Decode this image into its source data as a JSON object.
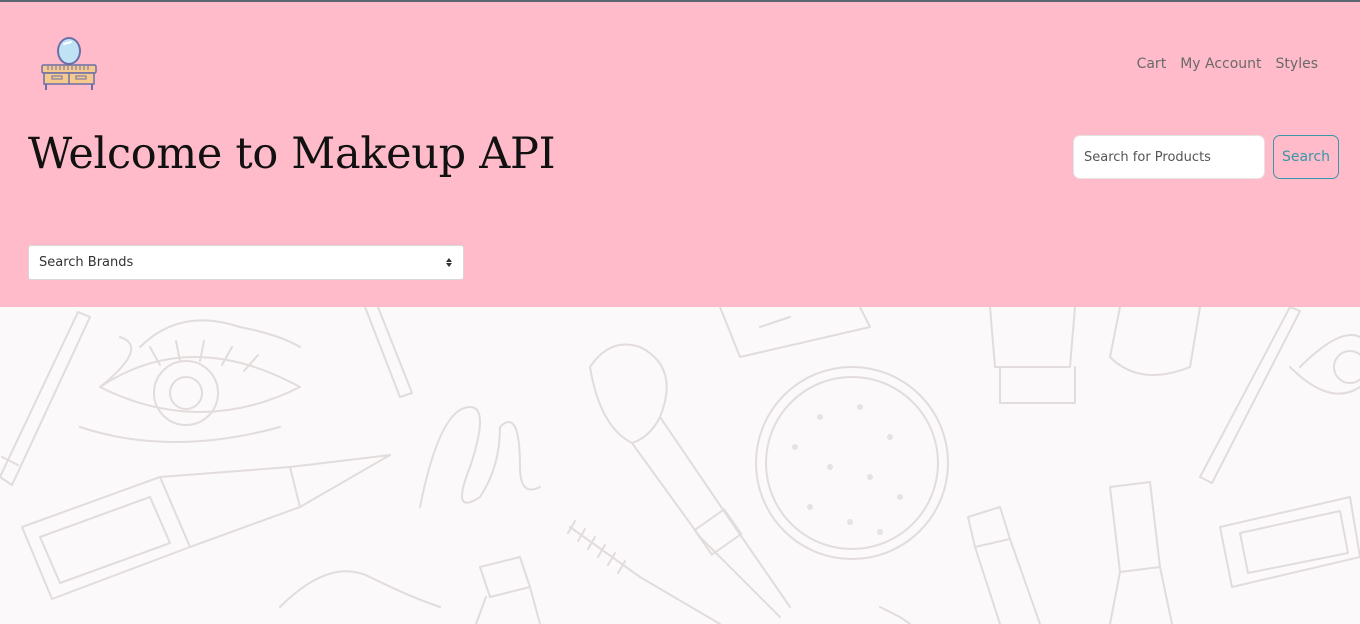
{
  "header": {
    "logo_icon": "vanity-mirror-icon",
    "nav": {
      "cart": "Cart",
      "my_account": "My Account",
      "styles": "Styles"
    },
    "title": "Welcome to Makeup API",
    "search": {
      "placeholder": "Search for Products",
      "button_label": "Search"
    },
    "brand_select": {
      "selected": "Search Brands"
    }
  },
  "colors": {
    "header_background": "#ffbbc9",
    "accent": "#3a96a8",
    "page_background": "#fbf9f9"
  },
  "background_pattern": {
    "icons": [
      "eye-icon",
      "makeup-brush-icon",
      "powder-compact-icon",
      "lipstick-icon",
      "eyeliner-pen-icon",
      "mascara-wand-icon",
      "nail-polish-icon",
      "pencil-icon",
      "palette-icon"
    ]
  }
}
